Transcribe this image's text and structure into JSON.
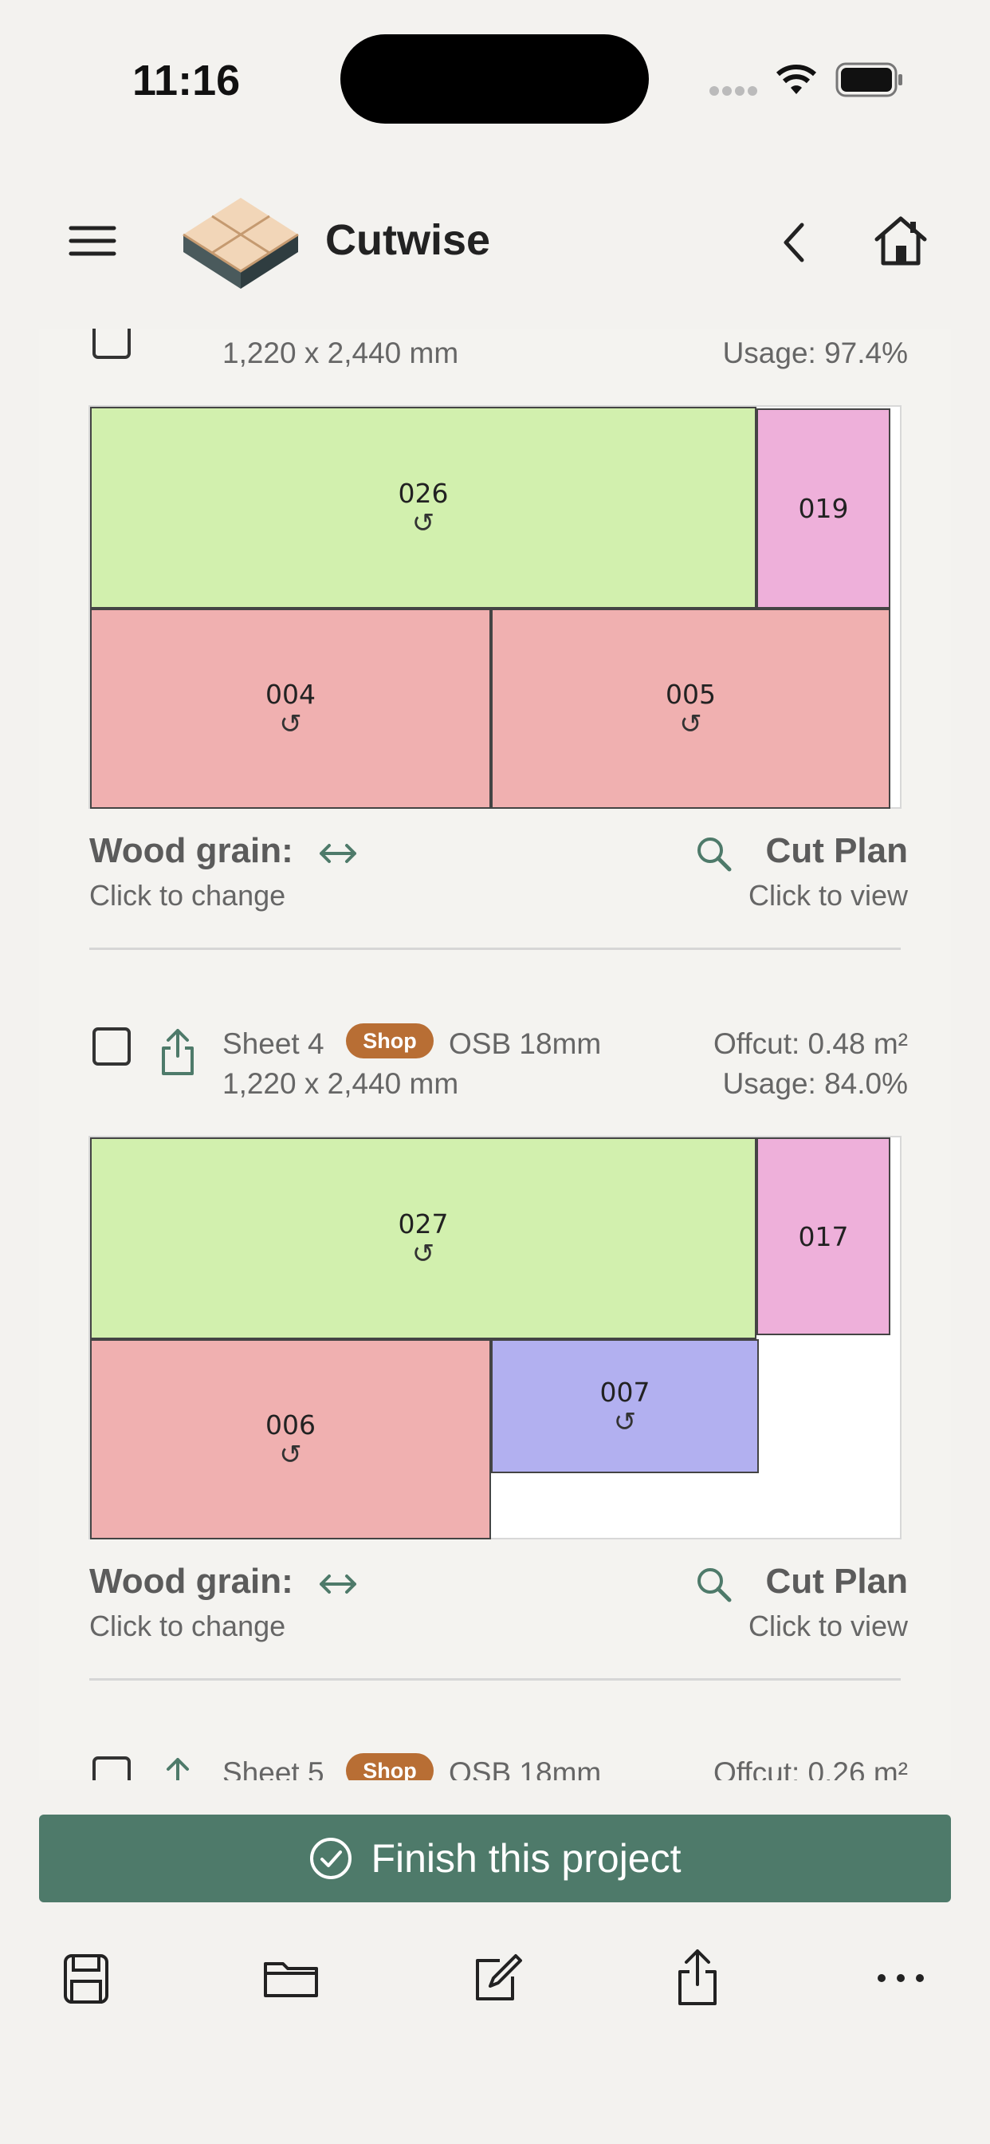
{
  "status_bar": {
    "time": "11:16"
  },
  "nav": {
    "title": "Cutwise"
  },
  "sheets": [
    {
      "dims": "1,220 x 2,440 mm",
      "offcut": "",
      "usage": "Usage: 97.4%",
      "pieces": [
        {
          "label": "026",
          "color": "#d2f0ae",
          "rotated": true
        },
        {
          "label": "019",
          "color": "#eeb0da",
          "rotated": false
        },
        {
          "label": "004",
          "color": "#f0b0b0",
          "rotated": true
        },
        {
          "label": "005",
          "color": "#f0b0b0",
          "rotated": true
        }
      ],
      "grain_label": "Wood grain:",
      "grain_hint": "Click to change",
      "cut_plan_label": "Cut Plan",
      "cut_plan_hint": "Click to view"
    },
    {
      "name": "Sheet 4",
      "badge": "Shop",
      "material": "OSB 18mm",
      "dims": "1,220 x 2,440 mm",
      "offcut": "Offcut: 0.48 m²",
      "usage": "Usage: 84.0%",
      "pieces": [
        {
          "label": "027",
          "color": "#d2f0ae",
          "rotated": true
        },
        {
          "label": "017",
          "color": "#eeb0da",
          "rotated": false
        },
        {
          "label": "006",
          "color": "#f0b0b0",
          "rotated": true
        },
        {
          "label": "007",
          "color": "#b2b0f0",
          "rotated": true
        }
      ],
      "grain_label": "Wood grain:",
      "grain_hint": "Click to change",
      "cut_plan_label": "Cut Plan",
      "cut_plan_hint": "Click to view"
    },
    {
      "name": "Sheet 5",
      "badge": "Shop",
      "material": "OSB 18mm",
      "offcut": "Offcut: 0.26 m²"
    }
  ],
  "finish_button": {
    "label": "Finish this project"
  },
  "rotate_glyph": "↺",
  "colors": {
    "accent": "#4e7a6a",
    "badge": "#b86e34"
  },
  "toolbar": {
    "icons": [
      "save-icon",
      "folder-icon",
      "edit-icon",
      "share-icon",
      "more-icon"
    ]
  }
}
